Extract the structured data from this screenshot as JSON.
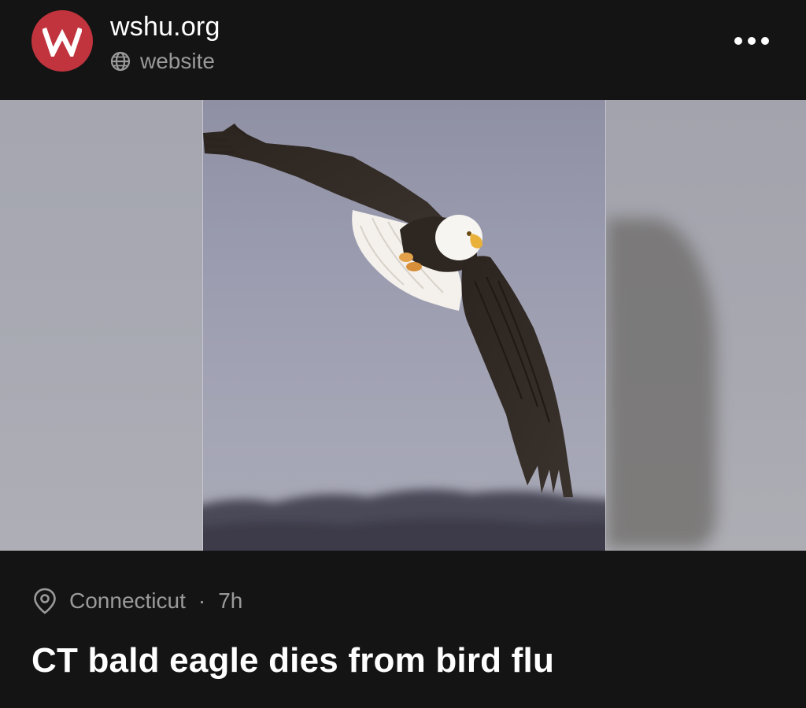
{
  "post": {
    "source": {
      "name": "wshu.org",
      "type_label": "website",
      "avatar_letter": "W",
      "avatar_color": "#c1343e"
    },
    "menu": {
      "icon": "more-horizontal-icon"
    },
    "media": {
      "description_icon": "photo"
    },
    "location": "Connecticut",
    "separator": "·",
    "time_ago": "7h",
    "headline": "CT bald eagle dies from bird flu"
  },
  "colors": {
    "background": "#141414",
    "primary_text": "#ffffff",
    "secondary_text": "#9a9a9a",
    "brand": "#c1343e"
  }
}
